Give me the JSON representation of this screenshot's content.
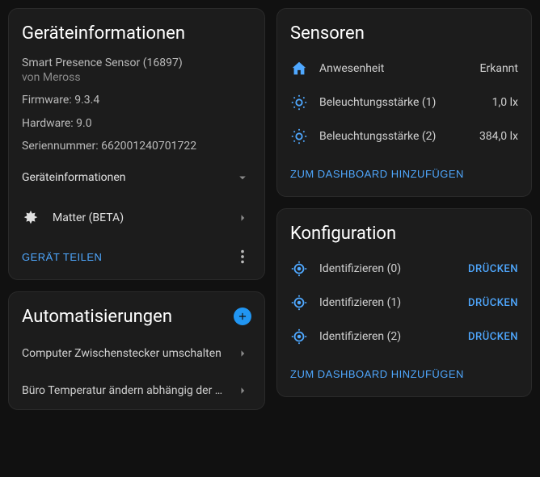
{
  "colors": {
    "accent": "#4fa8ff"
  },
  "device_info": {
    "title": "Geräteinformationen",
    "name": "Smart Presence Sensor (16897)",
    "by_prefix": "von ",
    "manufacturer": "Meross",
    "firmware_label": "Firmware: ",
    "firmware": "9.3.4",
    "hardware_label": "Hardware: ",
    "hardware": "9.0",
    "serial_label": "Seriennummer: ",
    "serial": "662001240701722",
    "expand_label": "Geräteinformationen",
    "integration_label": "Matter (BETA)",
    "share_label": "GERÄT TEILEN"
  },
  "automations": {
    "title": "Automatisierungen",
    "items": [
      "Computer Zwischenstecker umschalten",
      "Büro Temperatur ändern abhängig der …"
    ]
  },
  "sensors": {
    "title": "Sensoren",
    "rows": [
      {
        "icon": "home",
        "label": "Anwesenheit",
        "value": "Erkannt"
      },
      {
        "icon": "brightness",
        "label": "Beleuchtungsstärke (1)",
        "value": "1,0 lx"
      },
      {
        "icon": "brightness",
        "label": "Beleuchtungsstärke (2)",
        "value": "384,0 lx"
      }
    ],
    "add_label": "ZUM DASHBOARD HINZUFÜGEN"
  },
  "config": {
    "title": "Konfiguration",
    "rows": [
      {
        "label": "Identifizieren (0)",
        "action": "DRÜCKEN"
      },
      {
        "label": "Identifizieren (1)",
        "action": "DRÜCKEN"
      },
      {
        "label": "Identifizieren (2)",
        "action": "DRÜCKEN"
      }
    ],
    "add_label": "ZUM DASHBOARD HINZUFÜGEN"
  }
}
